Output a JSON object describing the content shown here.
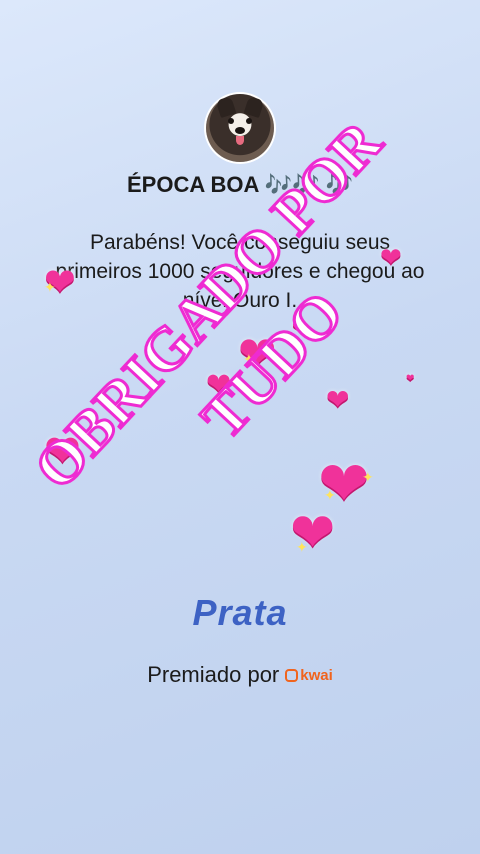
{
  "profile": {
    "username": "ÉPOCA BOA 🎶🎶 🎶",
    "avatar_icon": "dog-avatar-icon"
  },
  "message": {
    "text": "Parabéns! Você conseguiu seus primeiros 1000 seguidores e chegou ao nível Ouro I."
  },
  "overlay": {
    "line1": "OBRIGADO POR",
    "line2": "TUDO",
    "fill_color": "#ffffff",
    "stroke_color": "#ee2bd2"
  },
  "badge": {
    "level": "Prata",
    "color": "#3d62c4"
  },
  "award": {
    "prefix": "Premiado por",
    "brand": "kwai",
    "brand_color": "#f0641e"
  },
  "decorations": {
    "heart_glyph": "❤",
    "sparkle_glyph": "✦",
    "heart_color": "#f0329a"
  }
}
